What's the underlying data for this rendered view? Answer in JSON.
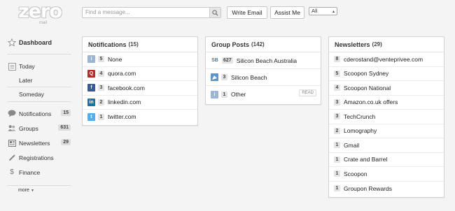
{
  "logo": {
    "text": "zero",
    "sub": "mail"
  },
  "search": {
    "placeholder": "Find a message..."
  },
  "toolbar": {
    "write_email": "Write Email",
    "assist_me": "Assist Me",
    "filter_value": "All"
  },
  "sidebar": {
    "dashboard": "Dashboard",
    "today": "Today",
    "later": "Later",
    "someday": "Someday",
    "notifications": {
      "label": "Notifications",
      "count": "15"
    },
    "groups": {
      "label": "Groups",
      "count": "631"
    },
    "newsletters": {
      "label": "Newsletters",
      "count": "29"
    },
    "registrations": "Registrations",
    "finance": "Finance",
    "more": "more"
  },
  "notifications": {
    "title": "Notifications",
    "count": "(15)",
    "rows": [
      {
        "count": "5",
        "label": "None",
        "icon": "info-icon"
      },
      {
        "count": "4",
        "label": "quora.com",
        "icon": "quora-icon"
      },
      {
        "count": "3",
        "label": "facebook.com",
        "icon": "facebook-icon"
      },
      {
        "count": "2",
        "label": "linkedin.com",
        "icon": "linkedin-icon"
      },
      {
        "count": "1",
        "label": "twitter.com",
        "icon": "twitter-icon"
      }
    ]
  },
  "groups": {
    "title": "Group Posts",
    "count": "(142)",
    "rows": [
      {
        "prefix": "SB",
        "count": "627",
        "label": "Silicon Beach Australia"
      },
      {
        "prefix": "",
        "count": "3",
        "label": "Silicon Beach"
      },
      {
        "prefix": "",
        "count": "1",
        "label": "Other",
        "action": "READ"
      }
    ]
  },
  "newsletters": {
    "title": "Newsletters",
    "count": "(29)",
    "rows": [
      {
        "count": "8",
        "label": "cderostand@venteprivee.com"
      },
      {
        "count": "5",
        "label": "Scoopon Sydney"
      },
      {
        "count": "4",
        "label": "Scoopon National"
      },
      {
        "count": "3",
        "label": "Amazon.co.uk offers"
      },
      {
        "count": "3",
        "label": "TechCrunch"
      },
      {
        "count": "2",
        "label": "Lomography"
      },
      {
        "count": "1",
        "label": "Gmail"
      },
      {
        "count": "1",
        "label": "Crate and Barrel"
      },
      {
        "count": "1",
        "label": "Scoopon"
      },
      {
        "count": "1",
        "label": "Groupon Rewards"
      }
    ]
  },
  "colors": {
    "quora": "#b92b27",
    "facebook": "#3b5998",
    "linkedin": "#0e76a8",
    "twitter": "#55acee",
    "info": "#9bb5d6"
  }
}
